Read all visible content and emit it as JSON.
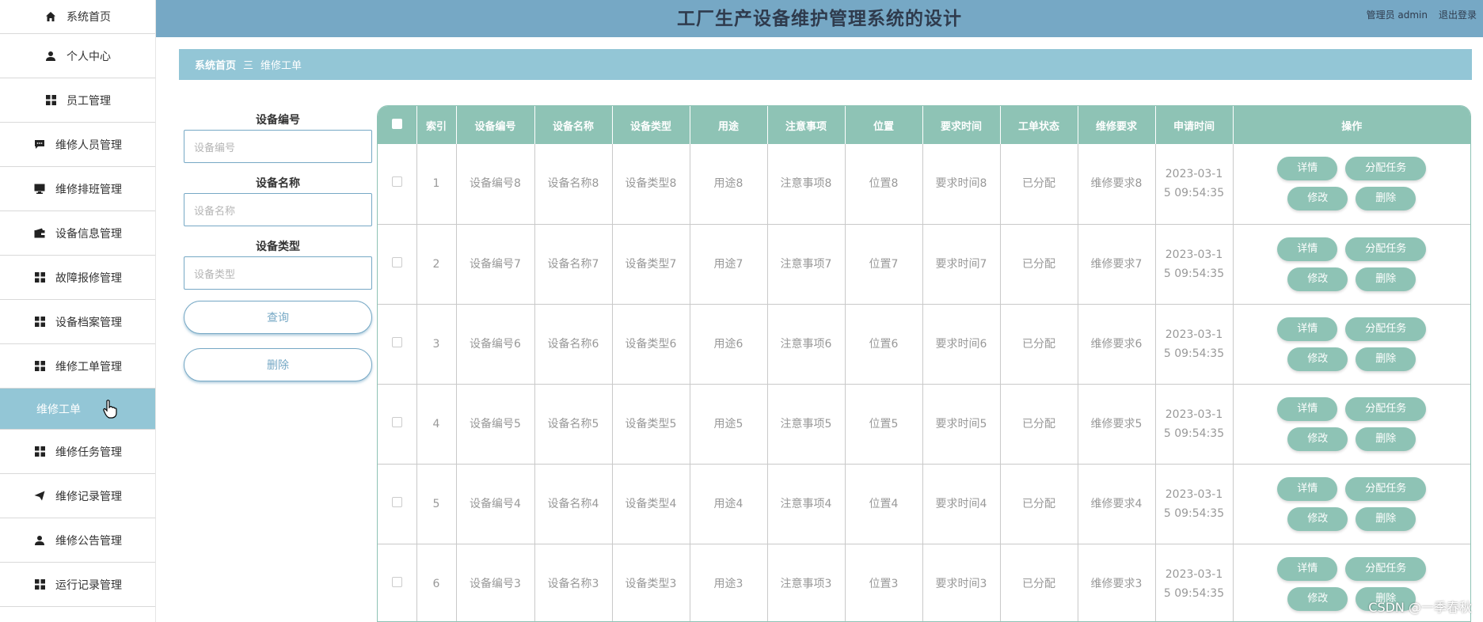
{
  "app": {
    "title": "工厂生产设备维护管理系统的设计",
    "user_label": "管理员 admin",
    "logout_label": "退出登录"
  },
  "sidebar": {
    "items": [
      {
        "label": "系统首页",
        "icon": "home-icon"
      },
      {
        "label": "个人中心",
        "icon": "user-icon"
      },
      {
        "label": "员工管理",
        "icon": "grid-icon"
      },
      {
        "label": "维修人员管理",
        "icon": "chat-icon"
      },
      {
        "label": "维修排班管理",
        "icon": "monitor-icon"
      },
      {
        "label": "设备信息管理",
        "icon": "wallet-icon"
      },
      {
        "label": "故障报修管理",
        "icon": "grid-icon"
      },
      {
        "label": "设备档案管理",
        "icon": "grid-icon"
      },
      {
        "label": "维修工单管理",
        "icon": "grid-icon"
      },
      {
        "label": "维修工单",
        "icon": "",
        "active": true
      },
      {
        "label": "维修任务管理",
        "icon": "grid-icon"
      },
      {
        "label": "维修记录管理",
        "icon": "send-icon"
      },
      {
        "label": "维修公告管理",
        "icon": "user-icon"
      },
      {
        "label": "运行记录管理",
        "icon": "grid-icon"
      }
    ]
  },
  "breadcrumb": {
    "home": "系统首页",
    "separator": "三",
    "current": "维修工单"
  },
  "search": {
    "fields": [
      {
        "label": "设备编号",
        "placeholder": "设备编号"
      },
      {
        "label": "设备名称",
        "placeholder": "设备名称"
      },
      {
        "label": "设备类型",
        "placeholder": "设备类型"
      }
    ],
    "query_label": "查询",
    "delete_label": "删除"
  },
  "table": {
    "columns": [
      "索引",
      "设备编号",
      "设备名称",
      "设备类型",
      "用途",
      "注意事项",
      "位置",
      "要求时间",
      "工单状态",
      "维修要求",
      "申请时间",
      "操作"
    ],
    "actions": {
      "detail": "详情",
      "assign": "分配任务",
      "edit": "修改",
      "delete": "删除"
    },
    "rows": [
      {
        "index": "1",
        "code": "设备编号8",
        "name": "设备名称8",
        "type": "设备类型8",
        "use": "用途8",
        "note": "注意事项8",
        "location": "位置8",
        "req_time": "要求时间8",
        "status": "已分配",
        "repair_req": "维修要求8",
        "apply_time_a": "2023-03-1",
        "apply_time_b": "5 09:54:35"
      },
      {
        "index": "2",
        "code": "设备编号7",
        "name": "设备名称7",
        "type": "设备类型7",
        "use": "用途7",
        "note": "注意事项7",
        "location": "位置7",
        "req_time": "要求时间7",
        "status": "已分配",
        "repair_req": "维修要求7",
        "apply_time_a": "2023-03-1",
        "apply_time_b": "5 09:54:35"
      },
      {
        "index": "3",
        "code": "设备编号6",
        "name": "设备名称6",
        "type": "设备类型6",
        "use": "用途6",
        "note": "注意事项6",
        "location": "位置6",
        "req_time": "要求时间6",
        "status": "已分配",
        "repair_req": "维修要求6",
        "apply_time_a": "2023-03-1",
        "apply_time_b": "5 09:54:35"
      },
      {
        "index": "4",
        "code": "设备编号5",
        "name": "设备名称5",
        "type": "设备类型5",
        "use": "用途5",
        "note": "注意事项5",
        "location": "位置5",
        "req_time": "要求时间5",
        "status": "已分配",
        "repair_req": "维修要求5",
        "apply_time_a": "2023-03-1",
        "apply_time_b": "5 09:54:35"
      },
      {
        "index": "5",
        "code": "设备编号4",
        "name": "设备名称4",
        "type": "设备类型4",
        "use": "用途4",
        "note": "注意事项4",
        "location": "位置4",
        "req_time": "要求时间4",
        "status": "已分配",
        "repair_req": "维修要求4",
        "apply_time_a": "2023-03-1",
        "apply_time_b": "5 09:54:35"
      },
      {
        "index": "6",
        "code": "设备编号3",
        "name": "设备名称3",
        "type": "设备类型3",
        "use": "用途3",
        "note": "注意事项3",
        "location": "位置3",
        "req_time": "要求时间3",
        "status": "已分配",
        "repair_req": "维修要求3",
        "apply_time_a": "2023-03-1",
        "apply_time_b": "5 09:54:35"
      }
    ]
  },
  "watermark": "CSDN @一季春秋",
  "colors": {
    "header": "#76a8c5",
    "accent": "#93c6d6",
    "table_head": "#8ec3b5"
  }
}
